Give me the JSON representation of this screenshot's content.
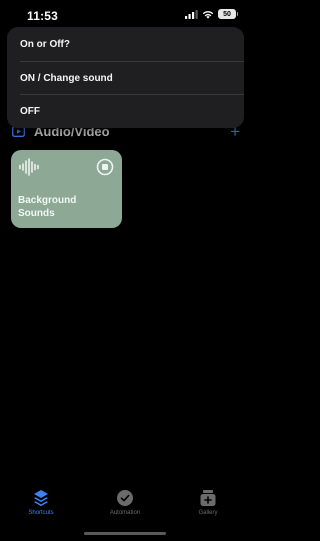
{
  "status_bar": {
    "time": "11:53",
    "battery": "50"
  },
  "menu": {
    "title": "On or Off?",
    "options": [
      "ON / Change sound",
      "OFF"
    ]
  },
  "section": {
    "title": "Audio/Video",
    "icon": "play-rectangle-icon",
    "add_icon": "plus-icon",
    "accent_color": "#3b82f6"
  },
  "shortcut_card": {
    "title": "Background Sounds",
    "color": "#8da895",
    "icons": [
      "waveform-icon",
      "stop-icon"
    ]
  },
  "tabs": [
    {
      "label": "Shortcuts",
      "icon": "stack-icon",
      "active": true
    },
    {
      "label": "Automation",
      "icon": "clock-check-icon",
      "active": false
    },
    {
      "label": "Gallery",
      "icon": "gallery-plus-icon",
      "active": false
    }
  ]
}
